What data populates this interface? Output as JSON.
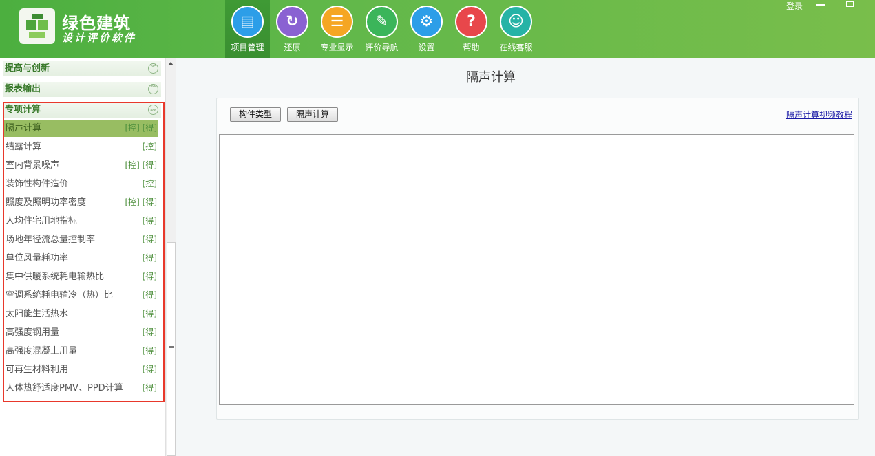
{
  "app": {
    "title": "绿色建筑",
    "subtitle": "设计评价软件"
  },
  "toolbar": {
    "items": [
      {
        "label": "项目管理",
        "icon": "project-icon",
        "glyph": "▤",
        "color": "#2c9ee8"
      },
      {
        "label": "还原",
        "icon": "restore-icon",
        "glyph": "↻",
        "color": "#8a62d2"
      },
      {
        "label": "专业显示",
        "icon": "list-icon",
        "glyph": "☰",
        "color": "#f5a623"
      },
      {
        "label": "评价导航",
        "icon": "edit-icon",
        "glyph": "✎",
        "color": "#3bb55a"
      },
      {
        "label": "设置",
        "icon": "gear-icon",
        "glyph": "⚙",
        "color": "#2c9ee8"
      },
      {
        "label": "帮助",
        "icon": "help-icon",
        "glyph": "?",
        "color": "#e8474b"
      },
      {
        "label": "在线客服",
        "icon": "support-icon",
        "glyph": "☺",
        "color": "#26b3a6"
      }
    ]
  },
  "window": {
    "login": "登录"
  },
  "sidebar": {
    "sections": [
      {
        "label": "提高与创新",
        "toggle": "︾"
      },
      {
        "label": "报表输出",
        "toggle": "︾"
      },
      {
        "label": "专项计算",
        "toggle": "︽"
      }
    ],
    "items": [
      {
        "label": "隔声计算",
        "tags": "[控] [得]"
      },
      {
        "label": "结露计算",
        "tags": "[控]"
      },
      {
        "label": "室内背景噪声",
        "tags": "[控] [得]"
      },
      {
        "label": "装饰性构件造价",
        "tags": "[控]"
      },
      {
        "label": "照度及照明功率密度",
        "tags": "[控] [得]"
      },
      {
        "label": "人均住宅用地指标",
        "tags": "[得]"
      },
      {
        "label": "场地年径流总量控制率",
        "tags": "[得]"
      },
      {
        "label": "单位风量耗功率",
        "tags": "[得]"
      },
      {
        "label": "集中供暖系统耗电输热比",
        "tags": "[得]"
      },
      {
        "label": "空调系统耗电输冷（热）比",
        "tags": "[得]"
      },
      {
        "label": "太阳能生活热水",
        "tags": "[得]"
      },
      {
        "label": "高强度钢用量",
        "tags": "[得]"
      },
      {
        "label": "高强度混凝土用量",
        "tags": "[得]"
      },
      {
        "label": "可再生材料利用",
        "tags": "[得]"
      },
      {
        "label": "人体热舒适度PMV、PPD计算",
        "tags": "[得]"
      }
    ]
  },
  "main": {
    "title": "隔声计算",
    "buttons": {
      "component_type": "构件类型",
      "sound_calc": "隔声计算"
    },
    "video_link": "隔声计算视频教程"
  }
}
